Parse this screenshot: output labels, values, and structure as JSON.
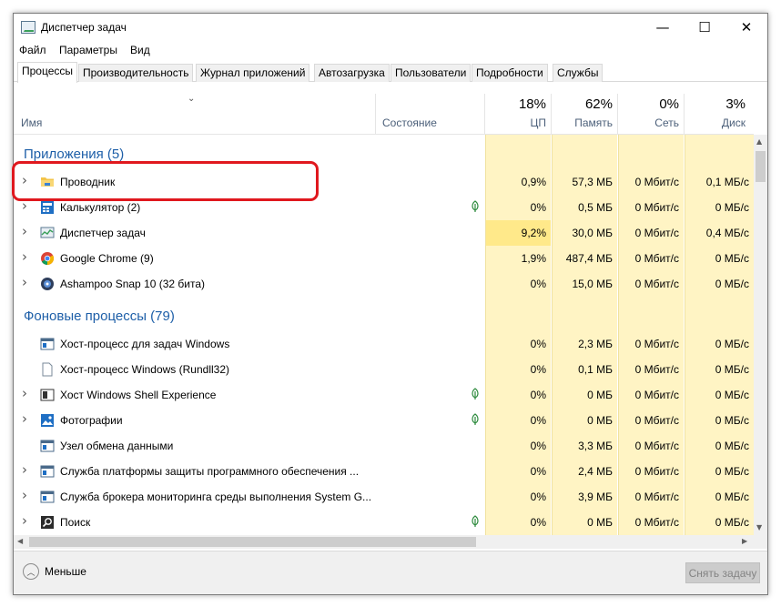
{
  "window": {
    "title": "Диспетчер задач",
    "controls": {
      "minimize": "—",
      "maximize": "☐",
      "close": "✕"
    }
  },
  "menu": [
    "Файл",
    "Параметры",
    "Вид"
  ],
  "tabs": [
    "Процессы",
    "Производительность",
    "Журнал приложений",
    "Автозагрузка",
    "Пользователи",
    "Подробности",
    "Службы"
  ],
  "active_tab": "Процессы",
  "columns": {
    "name": "Имя",
    "status": "Состояние",
    "cpu": {
      "pct": "18%",
      "label": "ЦП"
    },
    "memory": {
      "pct": "62%",
      "label": "Память"
    },
    "network": {
      "pct": "0%",
      "label": "Сеть"
    },
    "disk": {
      "pct": "3%",
      "label": "Диск"
    }
  },
  "groups": {
    "apps": "Приложения (5)",
    "background": "Фоновые процессы (79)"
  },
  "apps": [
    {
      "name": "Проводник",
      "icon": "folder-icon",
      "expandable": true,
      "leaf": false,
      "cpu": "0,9%",
      "mem": "57,3 МБ",
      "net": "0 Мбит/с",
      "disk": "0,1 МБ/с"
    },
    {
      "name": "Калькулятор (2)",
      "icon": "calculator-icon",
      "expandable": true,
      "leaf": true,
      "cpu": "0%",
      "mem": "0,5 МБ",
      "net": "0 Мбит/с",
      "disk": "0 МБ/с"
    },
    {
      "name": "Диспетчер задач",
      "icon": "task-manager-icon",
      "expandable": true,
      "leaf": false,
      "cpu": "9,2%",
      "mem": "30,0 МБ",
      "net": "0 Мбит/с",
      "disk": "0,4 МБ/с"
    },
    {
      "name": "Google Chrome (9)",
      "icon": "chrome-icon",
      "expandable": true,
      "leaf": false,
      "cpu": "1,9%",
      "mem": "487,4 МБ",
      "net": "0 Мбит/с",
      "disk": "0 МБ/с"
    },
    {
      "name": "Ashampoo Snap 10 (32 бита)",
      "icon": "ashampoo-icon",
      "expandable": true,
      "leaf": false,
      "cpu": "0%",
      "mem": "15,0 МБ",
      "net": "0 Мбит/с",
      "disk": "0 МБ/с"
    }
  ],
  "background": [
    {
      "name": "Хост-процесс для задач Windows",
      "icon": "window-app-icon",
      "expandable": false,
      "leaf": false,
      "cpu": "0%",
      "mem": "2,3 МБ",
      "net": "0 Мбит/с",
      "disk": "0 МБ/с"
    },
    {
      "name": "Хост-процесс Windows (Rundll32)",
      "icon": "document-icon",
      "expandable": false,
      "leaf": false,
      "cpu": "0%",
      "mem": "0,1 МБ",
      "net": "0 Мбит/с",
      "disk": "0 МБ/с"
    },
    {
      "name": "Хост Windows Shell Experience",
      "icon": "shell-icon",
      "expandable": true,
      "leaf": true,
      "cpu": "0%",
      "mem": "0 МБ",
      "net": "0 Мбит/с",
      "disk": "0 МБ/с"
    },
    {
      "name": "Фотографии",
      "icon": "photos-icon",
      "expandable": true,
      "leaf": true,
      "cpu": "0%",
      "mem": "0 МБ",
      "net": "0 Мбит/с",
      "disk": "0 МБ/с"
    },
    {
      "name": "Узел обмена данными",
      "icon": "window-app-icon",
      "expandable": false,
      "leaf": false,
      "cpu": "0%",
      "mem": "3,3 МБ",
      "net": "0 Мбит/с",
      "disk": "0 МБ/с"
    },
    {
      "name": "Служба платформы защиты программного обеспечения ...",
      "icon": "window-app-icon",
      "expandable": true,
      "leaf": false,
      "cpu": "0%",
      "mem": "2,4 МБ",
      "net": "0 Мбит/с",
      "disk": "0 МБ/с"
    },
    {
      "name": "Служба брокера мониторинга среды выполнения System G...",
      "icon": "window-app-icon",
      "expandable": true,
      "leaf": false,
      "cpu": "0%",
      "mem": "3,9 МБ",
      "net": "0 Мбит/с",
      "disk": "0 МБ/с"
    },
    {
      "name": "Поиск",
      "icon": "search-icon",
      "expandable": true,
      "leaf": true,
      "cpu": "0%",
      "mem": "0 МБ",
      "net": "0 Мбит/с",
      "disk": "0 МБ/с"
    }
  ],
  "footer": {
    "less_label": "Меньше",
    "end_task_label": "Снять задачу"
  },
  "colors": {
    "group_title": "#1e5fa8",
    "cell_light": "#fff4c4",
    "cell_medium": "#ffe98a",
    "highlight_border": "#e0181e"
  }
}
